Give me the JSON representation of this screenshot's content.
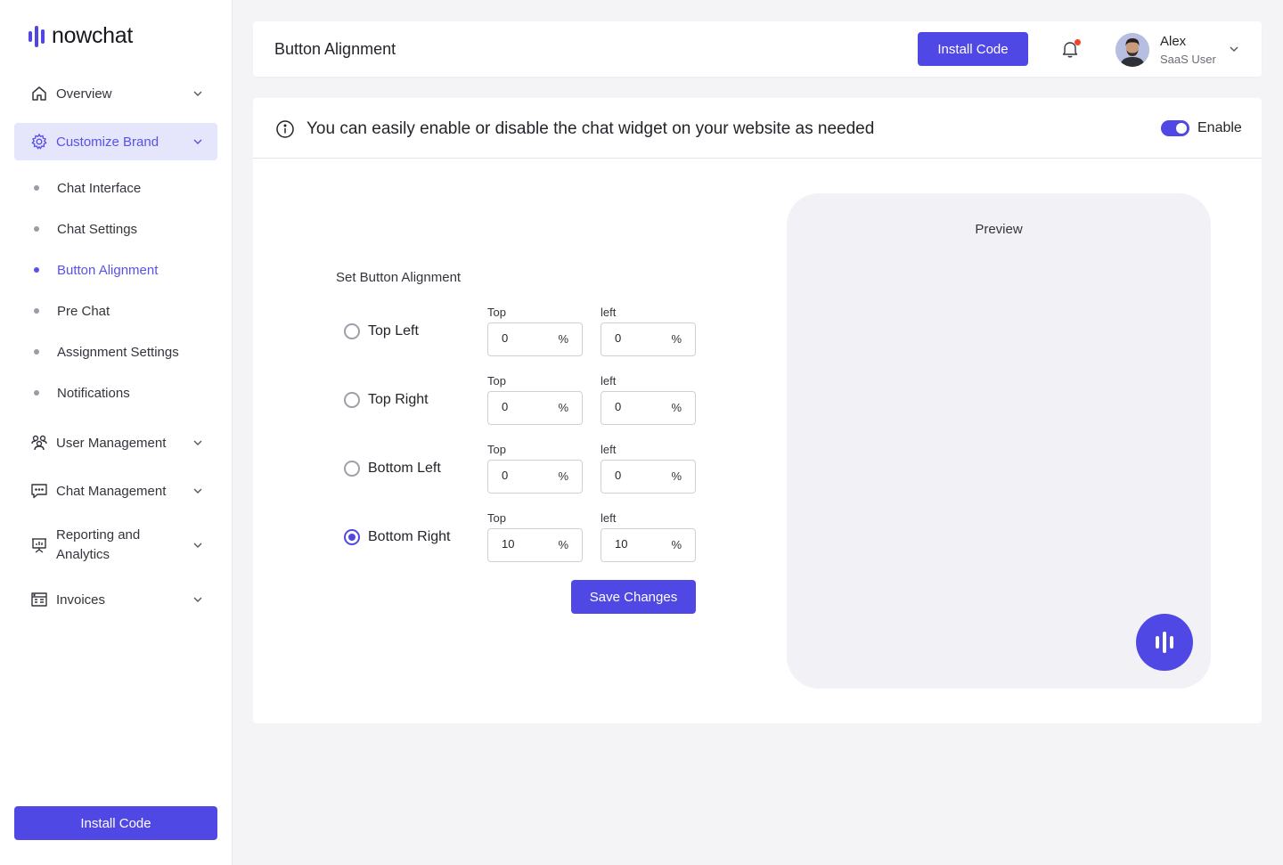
{
  "brand": {
    "name": "nowchat",
    "accent": "#5048e5"
  },
  "sidebar": {
    "items": [
      {
        "label": "Overview",
        "icon": "home-icon"
      },
      {
        "label": "Customize Brand",
        "icon": "gear-icon",
        "active": true
      },
      {
        "label": "User Management",
        "icon": "users-icon"
      },
      {
        "label": "Chat Management",
        "icon": "chat-icon"
      },
      {
        "label": "Reporting and Analytics",
        "icon": "presentation-chart-icon"
      },
      {
        "label": "Invoices",
        "icon": "invoice-icon"
      }
    ],
    "sub_items": [
      {
        "label": "Chat Interface"
      },
      {
        "label": "Chat Settings"
      },
      {
        "label": "Button Alignment",
        "active": true
      },
      {
        "label": "Pre Chat"
      },
      {
        "label": "Assignment Settings"
      },
      {
        "label": "Notifications"
      }
    ],
    "install_label": "Install Code"
  },
  "header": {
    "title": "Button Alignment",
    "install_label": "Install Code",
    "user": {
      "name": "Alex",
      "role": "SaaS User"
    }
  },
  "widget": {
    "info_text": "You can easily enable or disable the chat widget on your website as needed",
    "toggle_label": "Enable",
    "enabled": true
  },
  "alignment": {
    "title": "Set Button Alignment",
    "unit": "%",
    "options": [
      {
        "label": "Top Left",
        "checked": false,
        "top_label": "Top",
        "left_label": "left",
        "top": "0",
        "left": "0"
      },
      {
        "label": "Top Right",
        "checked": false,
        "top_label": "Top",
        "left_label": "left",
        "top": "0",
        "left": "0"
      },
      {
        "label": "Bottom Left",
        "checked": false,
        "top_label": "Top",
        "left_label": "left",
        "top": "0",
        "left": "0"
      },
      {
        "label": "Bottom Right",
        "checked": true,
        "top_label": "Top",
        "left_label": "left",
        "top": "10",
        "left": "10"
      }
    ],
    "save_label": "Save Changes"
  },
  "preview": {
    "title": "Preview"
  }
}
